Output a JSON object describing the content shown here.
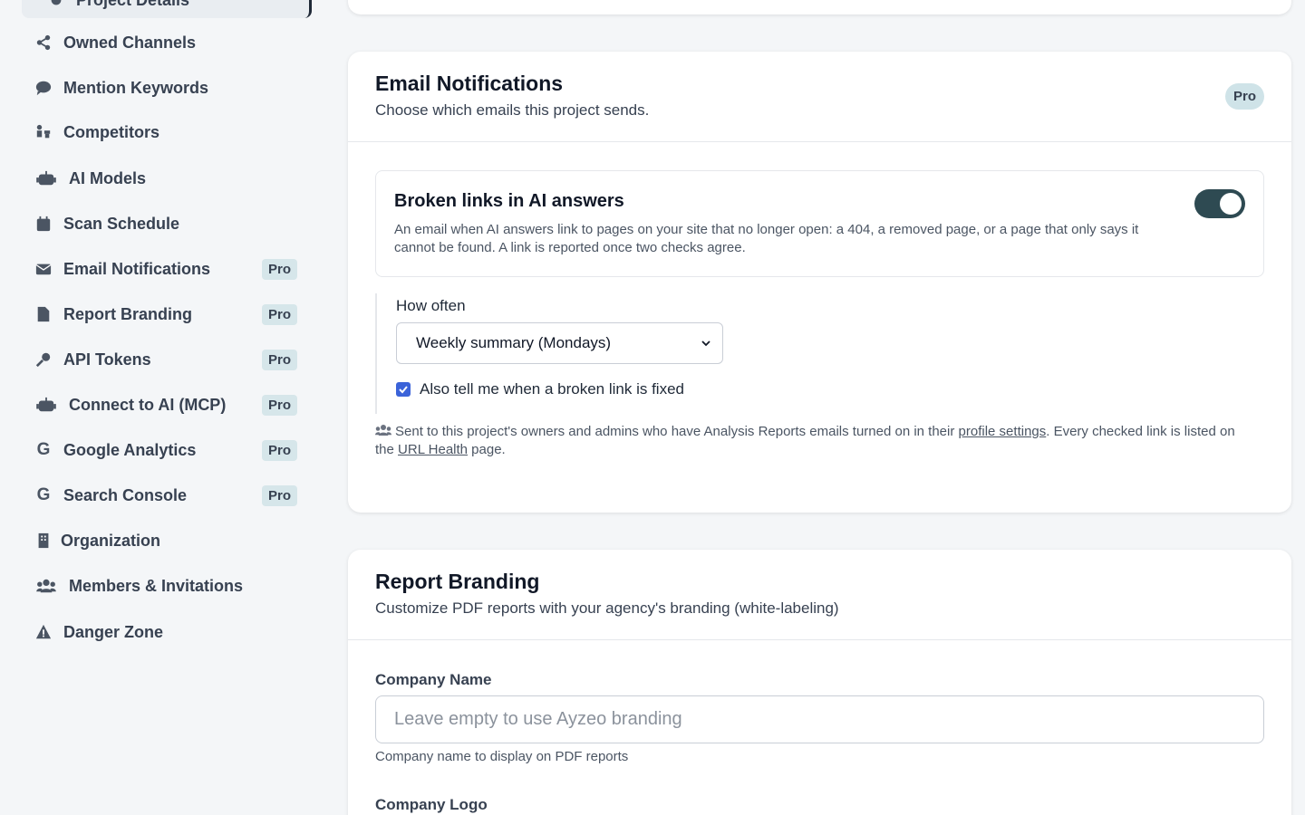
{
  "sidebar": {
    "active_label": "Project Details",
    "items": [
      {
        "label": "Owned Channels",
        "icon": "share-icon",
        "pro": ""
      },
      {
        "label": "Mention Keywords",
        "icon": "comment-icon",
        "pro": ""
      },
      {
        "label": "Competitors",
        "icon": "chess-icon",
        "pro": ""
      },
      {
        "label": "AI Models",
        "icon": "robot-icon",
        "pro": ""
      },
      {
        "label": "Scan Schedule",
        "icon": "calendar-icon",
        "pro": ""
      },
      {
        "label": "Email Notifications",
        "icon": "envelope-icon",
        "pro": "Pro"
      },
      {
        "label": "Report Branding",
        "icon": "pdf-file-icon",
        "pro": "Pro"
      },
      {
        "label": "API Tokens",
        "icon": "key-icon",
        "pro": "Pro"
      },
      {
        "label": "Connect to AI (MCP)",
        "icon": "robot-icon",
        "pro": "Pro"
      },
      {
        "label": "Google Analytics",
        "icon": "google-icon",
        "pro": "Pro"
      },
      {
        "label": "Search Console",
        "icon": "google-icon",
        "pro": "Pro"
      },
      {
        "label": "Organization",
        "icon": "building-icon",
        "pro": ""
      },
      {
        "label": "Members & Invitations",
        "icon": "users-icon",
        "pro": ""
      },
      {
        "label": "Danger Zone",
        "icon": "warning-icon",
        "pro": ""
      }
    ]
  },
  "email": {
    "title": "Email Notifications",
    "subtitle": "Choose which emails this project sends.",
    "pro": "Pro",
    "alert": {
      "title": "Broken links in AI answers",
      "description": "An email when AI answers link to pages on your site that no longer open: a 404, a removed page, or a page that only says it cannot be found. A link is reported once two checks agree.",
      "enabled": true
    },
    "how_often_label": "How often",
    "frequency": "Weekly summary (Mondays)",
    "fixed_checkbox_label": "Also tell me when a broken link is fixed",
    "fixed_checked": true,
    "note_part1": "Sent to this project's owners and admins who have Analysis Reports emails turned on in their ",
    "note_link1": "profile settings",
    "note_part2": ". Every checked link is listed on the ",
    "note_link2": "URL Health",
    "note_part3": " page."
  },
  "report": {
    "title": "Report Branding",
    "subtitle": "Customize PDF reports with your agency's branding (white-labeling)",
    "company_name_label": "Company Name",
    "company_name_placeholder": "Leave empty to use Ayzeo branding",
    "company_name_help": "Company name to display on PDF reports",
    "company_logo_label": "Company Logo"
  },
  "colors": {
    "toggle_on": "#2e4a52",
    "checkbox": "#3b63d9",
    "pro_badge": "#d6e6ea"
  }
}
